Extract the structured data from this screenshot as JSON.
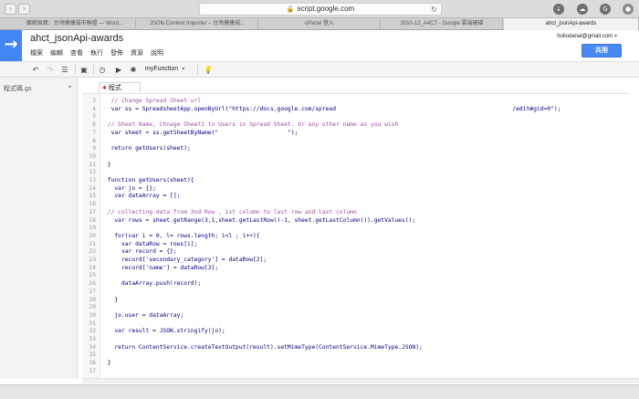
{
  "browser": {
    "url": "script.google.com",
    "tabs": [
      {
        "label": "國網頁面：台灣健康城市聯盟 — Word...",
        "active": false
      },
      {
        "label": "JSON Content Importer – 台灣健康城...",
        "active": false
      },
      {
        "label": "cPanel 登入",
        "active": false
      },
      {
        "label": "2010-12_A4CT - Google 雲端硬碟",
        "active": false
      },
      {
        "label": "ahct_jsonApi-awards",
        "active": true
      }
    ]
  },
  "app": {
    "title": "ahct_jsonApi-awards",
    "menu": [
      "檔案",
      "編輯",
      "查看",
      "執行",
      "發佈",
      "資源",
      "說明"
    ],
    "user_email": "holiodanal@gmail.com",
    "share_label": "共用"
  },
  "toolbar": {
    "function_name": "myFunction"
  },
  "sidebar": {
    "file_label": "程式碼.gs"
  },
  "editor": {
    "tab_label": "程式碼.gs",
    "lines": [
      {
        "n": "3",
        "text": "  // Change Spread Sheet url",
        "color": "#a050a0"
      },
      {
        "n": "4",
        "text": "  var ss = SpreadsheetApp.openByUrl(\"https://docs.google.com/spread                                                   /edit#gid=0\");",
        "color": "#000080"
      },
      {
        "n": "5",
        "text": "",
        "color": "#000"
      },
      {
        "n": "6",
        "text": " // Sheet Name, Chnage Sheet1 to Users in Spread Sheet. Or any other name as you wish",
        "color": "#a050a0"
      },
      {
        "n": "7",
        "text": "  var sheet = ss.getSheetByName(\"                    \");",
        "color": "#000080"
      },
      {
        "n": "8",
        "text": "",
        "color": "#000"
      },
      {
        "n": "9",
        "text": "  return getUsers(sheet);",
        "color": "#000080"
      },
      {
        "n": "10",
        "text": "",
        "color": "#000"
      },
      {
        "n": "11",
        "text": " }",
        "color": "#000"
      },
      {
        "n": "12",
        "text": "",
        "color": "#000"
      },
      {
        "n": "13",
        "text": " function getUsers(sheet){",
        "color": "#000080"
      },
      {
        "n": "14",
        "text": "   var jo = {};",
        "color": "#000080"
      },
      {
        "n": "15",
        "text": "   var dataArray = [];",
        "color": "#000080"
      },
      {
        "n": "16",
        "text": "",
        "color": "#000"
      },
      {
        "n": "17",
        "text": " // collecting data from 3nd Row , 1st column to last row and last column",
        "color": "#a050a0"
      },
      {
        "n": "18",
        "text": "   var rows = sheet.getRange(3,1,sheet.getLastRow()-1, sheet.getLastColumn()).getValues();",
        "color": "#000080"
      },
      {
        "n": "19",
        "text": "",
        "color": "#000"
      },
      {
        "n": "20",
        "text": "   for(var i = 0, l= rows.length; i<l ; i++){",
        "color": "#000080"
      },
      {
        "n": "21",
        "text": "     var dataRow = rows[i];",
        "color": "#000080"
      },
      {
        "n": "22",
        "text": "     var record = {};",
        "color": "#000080"
      },
      {
        "n": "23",
        "text": "     record['secondary_category'] = dataRow[2];",
        "color": "#000080"
      },
      {
        "n": "24",
        "text": "     record['name'] = dataRow[3];",
        "color": "#000080"
      },
      {
        "n": "25",
        "text": "",
        "color": "#000"
      },
      {
        "n": "26",
        "text": "     dataArray.push(record);",
        "color": "#000080"
      },
      {
        "n": "27",
        "text": "",
        "color": "#000"
      },
      {
        "n": "28",
        "text": "   }",
        "color": "#000"
      },
      {
        "n": "29",
        "text": "",
        "color": "#000"
      },
      {
        "n": "30",
        "text": "   jo.user = dataArray;",
        "color": "#000080"
      },
      {
        "n": "31",
        "text": "",
        "color": "#000"
      },
      {
        "n": "32",
        "text": "   var result = JSON.stringify(jo);",
        "color": "#000080"
      },
      {
        "n": "33",
        "text": "",
        "color": "#000"
      },
      {
        "n": "34",
        "text": "   return ContentService.createTextOutput(result).setMimeType(ContentService.MimeType.JSON);",
        "color": "#000080"
      },
      {
        "n": "35",
        "text": "",
        "color": "#000"
      },
      {
        "n": "36",
        "text": " }",
        "color": "#000"
      },
      {
        "n": "37",
        "text": "",
        "color": "#000"
      }
    ]
  },
  "colors": {
    "accent": "#4285f4",
    "share": "#4a8af4"
  }
}
